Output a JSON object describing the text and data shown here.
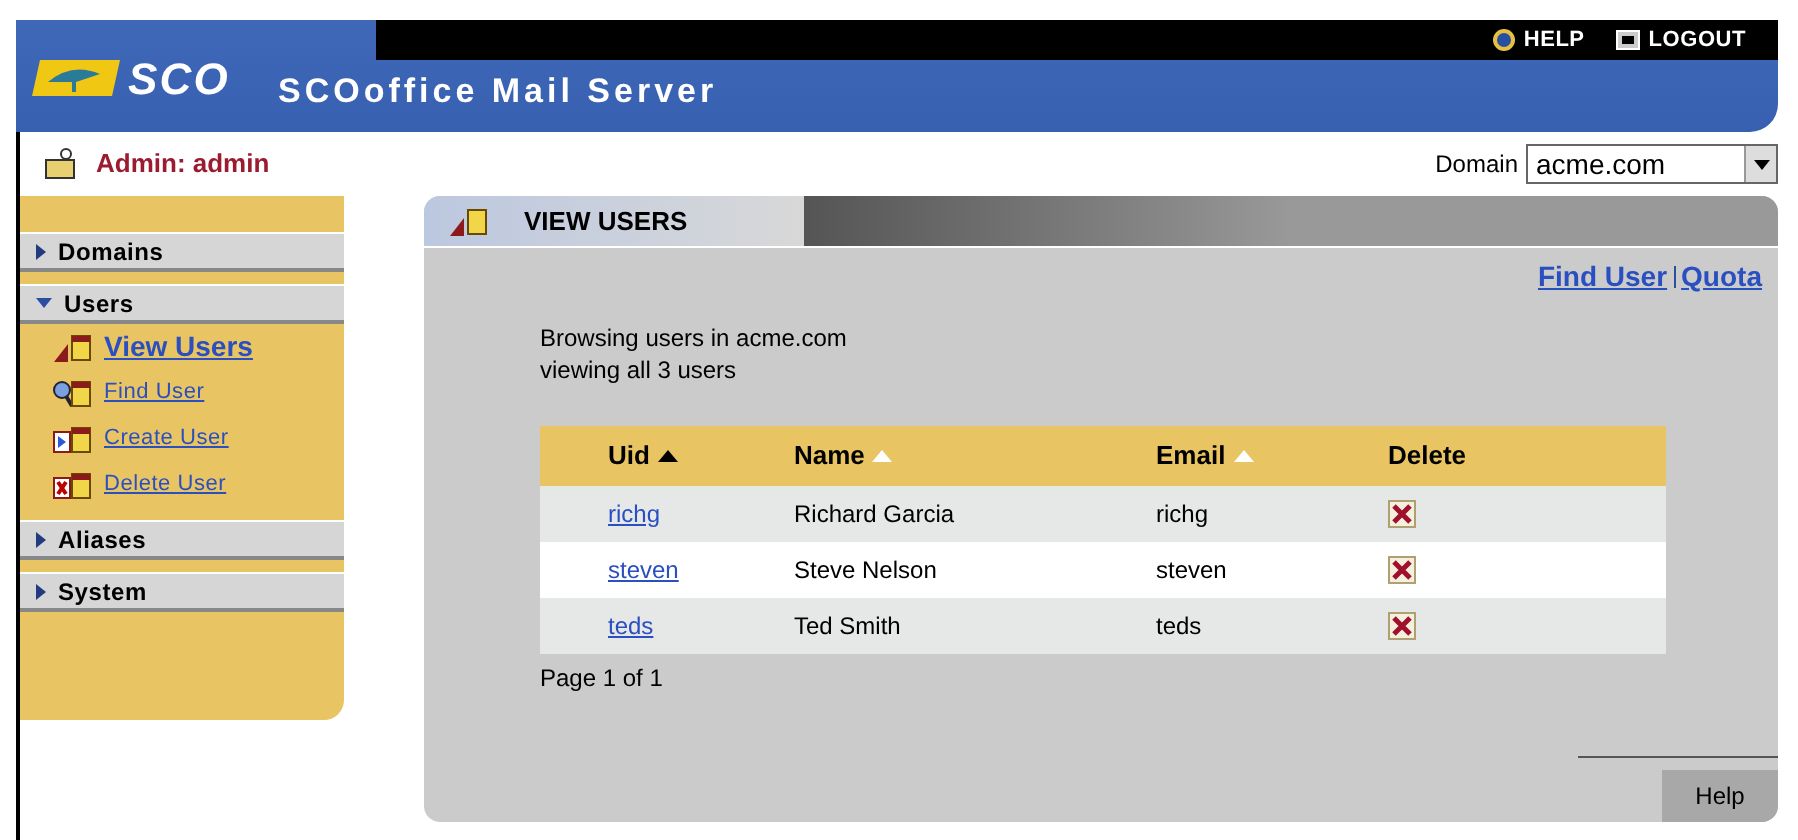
{
  "header": {
    "logo": "SCO",
    "title": "SCOoffice Mail Server",
    "links": [
      {
        "kind": "help",
        "label": "HELP"
      },
      {
        "kind": "logout",
        "label": "LOGOUT"
      }
    ]
  },
  "admin": {
    "label": "Admin: admin"
  },
  "domain": {
    "label": "Domain",
    "value": "acme.com"
  },
  "sidebar": {
    "sections": [
      {
        "label": "Domains",
        "expanded": false
      },
      {
        "label": "Users",
        "expanded": true,
        "children": [
          {
            "label": "View Users",
            "kind": "view",
            "selected": true
          },
          {
            "label": "Find User",
            "kind": "find",
            "selected": false
          },
          {
            "label": "Create User",
            "kind": "create",
            "selected": false
          },
          {
            "label": "Delete User",
            "kind": "delete",
            "selected": false
          }
        ]
      },
      {
        "label": "Aliases",
        "expanded": false
      },
      {
        "label": "System",
        "expanded": false
      }
    ]
  },
  "panel": {
    "title": "VIEW USERS",
    "links": [
      "Find User",
      "Quota"
    ],
    "info": [
      "Browsing users in acme.com",
      "viewing all 3 users"
    ],
    "table": {
      "columns": [
        {
          "label": "Uid",
          "kind": "sorted"
        },
        {
          "label": "Name",
          "kind": "sortable"
        },
        {
          "label": "Email",
          "kind": "sortable"
        },
        {
          "label": "Delete",
          "kind": "plain"
        }
      ],
      "rows": [
        {
          "uid": "richg",
          "name": "Richard Garcia",
          "email": "richg"
        },
        {
          "uid": "steven",
          "name": "Steve Nelson",
          "email": "steven"
        },
        {
          "uid": "teds",
          "name": "Ted Smith",
          "email": "teds"
        }
      ]
    },
    "pager": "Page 1 of 1",
    "help": "Help"
  }
}
